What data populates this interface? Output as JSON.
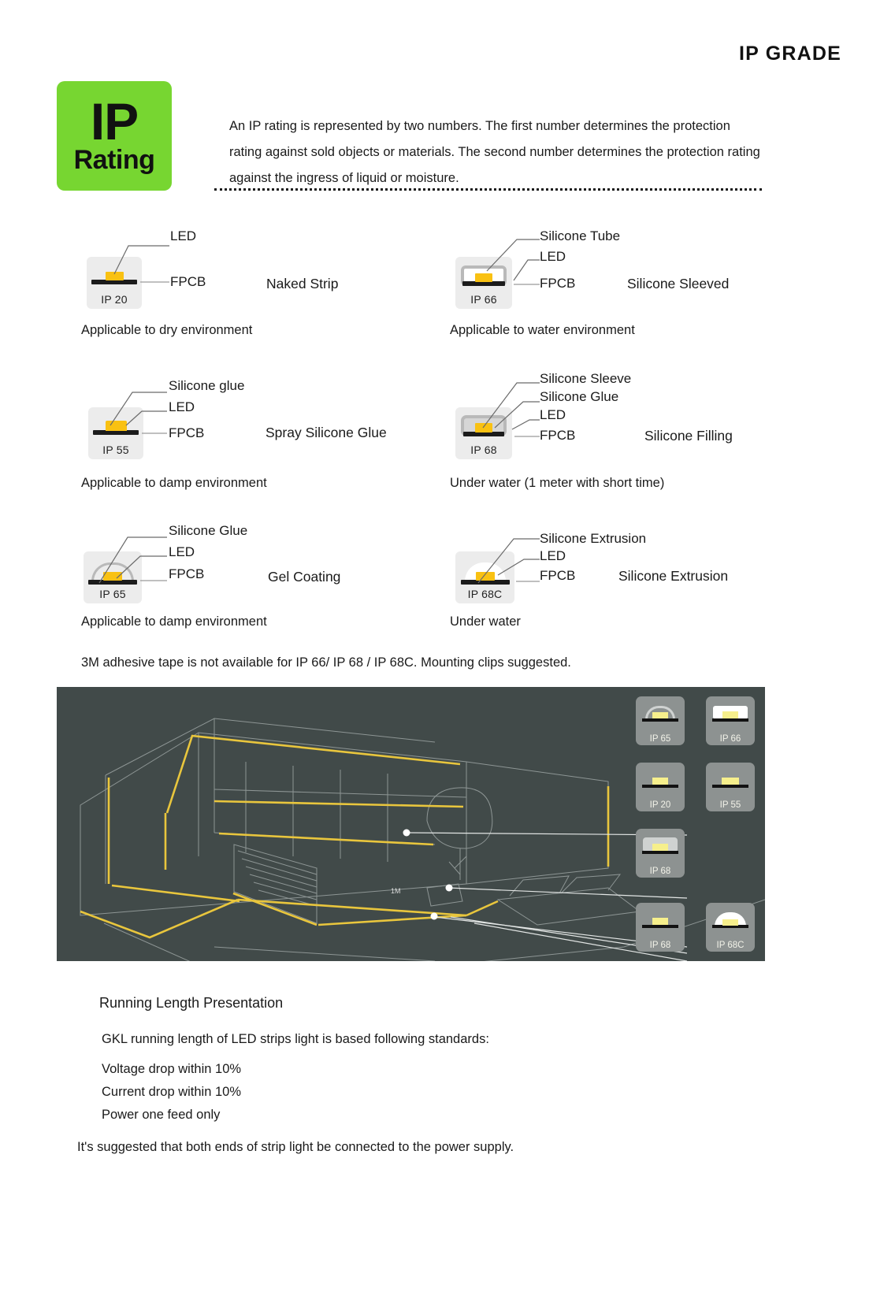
{
  "header": {
    "title": "IP GRADE"
  },
  "badge": {
    "line1": "IP",
    "line2": "Rating",
    "color": "#77d631"
  },
  "intro": {
    "text": "An IP rating is represented by two numbers. The first number determines the protection rating against sold objects or materials. The second number determines the protection rating against the ingress of liquid or moisture."
  },
  "labels": {
    "led": "LED",
    "fpcb": "FPCB"
  },
  "diagrams": [
    {
      "code": "IP 20",
      "type_name": "Naked Strip",
      "caption": "Applicable to dry environment",
      "callouts": [
        "LED",
        "FPCB"
      ]
    },
    {
      "code": "IP 66",
      "type_name": "Silicone Sleeved",
      "caption": "Applicable to water environment",
      "callouts": [
        "Silicone Tube",
        "LED",
        "FPCB"
      ]
    },
    {
      "code": "IP 55",
      "type_name": "Spray Silicone Glue",
      "caption": "Applicable to damp environment",
      "callouts": [
        "Silicone glue",
        "LED",
        "FPCB"
      ]
    },
    {
      "code": "IP 68",
      "type_name": "Silicone Filling",
      "caption": "Under water (1 meter with short time)",
      "callouts": [
        "Silicone Sleeve",
        "Silicone Glue",
        "LED",
        "FPCB"
      ]
    },
    {
      "code": "IP 65",
      "type_name": "Gel Coating",
      "caption": "Applicable to damp environment",
      "callouts": [
        "Silicone Glue",
        "LED",
        "FPCB"
      ]
    },
    {
      "code": "IP 68C",
      "type_name": "Silicone Extrusion",
      "caption": "Under water",
      "callouts": [
        "Silicone Extrusion",
        "LED",
        "FPCB"
      ]
    }
  ],
  "note": "3M adhesive tape is not available for IP 66/ IP 68 / IP 68C. Mounting clips suggested.",
  "photo": {
    "marker_label": "1M",
    "chips": [
      {
        "code": "IP 65"
      },
      {
        "code": "IP 66"
      },
      {
        "code": "IP 20"
      },
      {
        "code": "IP 55"
      },
      {
        "code": "IP 68"
      },
      {
        "code": "IP 68"
      },
      {
        "code": "IP 68C"
      }
    ]
  },
  "bottom": {
    "heading": "Running Length Presentation",
    "subheading": "GKL running length of LED strips light is based following standards:",
    "items": [
      "Voltage drop within 10%",
      "Current drop within 10%",
      "Power one feed only"
    ],
    "footer": "It's suggested that both ends of strip light be connected to the power supply."
  }
}
